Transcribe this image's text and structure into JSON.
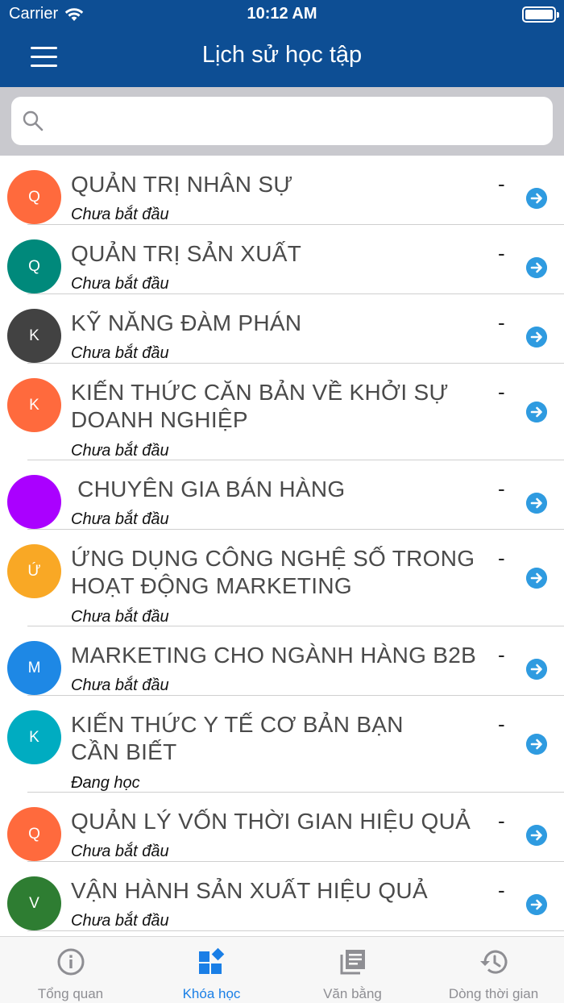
{
  "status_bar": {
    "carrier": "Carrier",
    "time": "10:12 AM"
  },
  "nav": {
    "title": "Lịch sử học tập",
    "menu_icon": "hamburger-menu-icon"
  },
  "search": {
    "placeholder": "",
    "value": "",
    "icon": "search-icon"
  },
  "courses": [
    {
      "initial": "Q",
      "title": "QUẢN TRỊ NHÂN SỰ",
      "status": "Chưa bắt đầu",
      "value": "-",
      "color": "#ff6a3d"
    },
    {
      "initial": "Q",
      "title": "QUẢN TRỊ SẢN XUẤT",
      "status": "Chưa bắt đầu",
      "value": "-",
      "color": "#00897b"
    },
    {
      "initial": "K",
      "title": "KỸ NĂNG ĐÀM PHÁN",
      "status": "Chưa bắt đầu",
      "value": "-",
      "color": "#424242"
    },
    {
      "initial": "K",
      "title": "KIẾN THỨC CĂN BẢN VỀ KHỞI SỰ DOANH NGHIỆP",
      "status": "Chưa bắt đầu",
      "value": "-",
      "color": "#ff6a3d"
    },
    {
      "initial": "",
      "title": " CHUYÊN GIA BÁN HÀNG",
      "status": "Chưa bắt đầu",
      "value": "-",
      "color": "#aa00ff"
    },
    {
      "initial": "Ứ",
      "title": "ỨNG DỤNG CÔNG NGHỆ SỐ TRONG HOẠT ĐỘNG MARKETING",
      "status": "Chưa bắt đầu",
      "value": "-",
      "color": "#f9a825"
    },
    {
      "initial": "M",
      "title": "MARKETING CHO NGÀNH HÀNG B2B",
      "status": "Chưa bắt đầu",
      "value": "-",
      "color": "#1e88e5"
    },
    {
      "initial": "K",
      "title": "KIẾN THỨC Y TẾ CƠ BẢN BẠN CẦN BIẾT",
      "status": "Đang học",
      "value": "-",
      "color": "#00acc1"
    },
    {
      "initial": "Q",
      "title": "QUẢN LÝ VỐN THỜI GIAN HIỆU QUẢ",
      "status": "Chưa bắt đầu",
      "value": "-",
      "color": "#ff6a3d"
    },
    {
      "initial": "V",
      "title": "VẬN HÀNH SẢN XUẤT HIỆU QUẢ",
      "status": "Chưa bắt đầu",
      "value": "-",
      "color": "#2e7d32"
    }
  ],
  "tabs": [
    {
      "label": "Tổng quan",
      "icon": "info-circle-icon",
      "active": false
    },
    {
      "label": "Khóa học",
      "icon": "apps-grid-icon",
      "active": true
    },
    {
      "label": "Văn bằng",
      "icon": "library-books-icon",
      "active": false
    },
    {
      "label": "Dòng thời gian",
      "icon": "history-clock-icon",
      "active": false
    }
  ],
  "colors": {
    "header": "#0d4e94",
    "accent": "#1a7fe6",
    "arrow": "#2f9be0",
    "inactive_tab": "#8e8e93"
  }
}
